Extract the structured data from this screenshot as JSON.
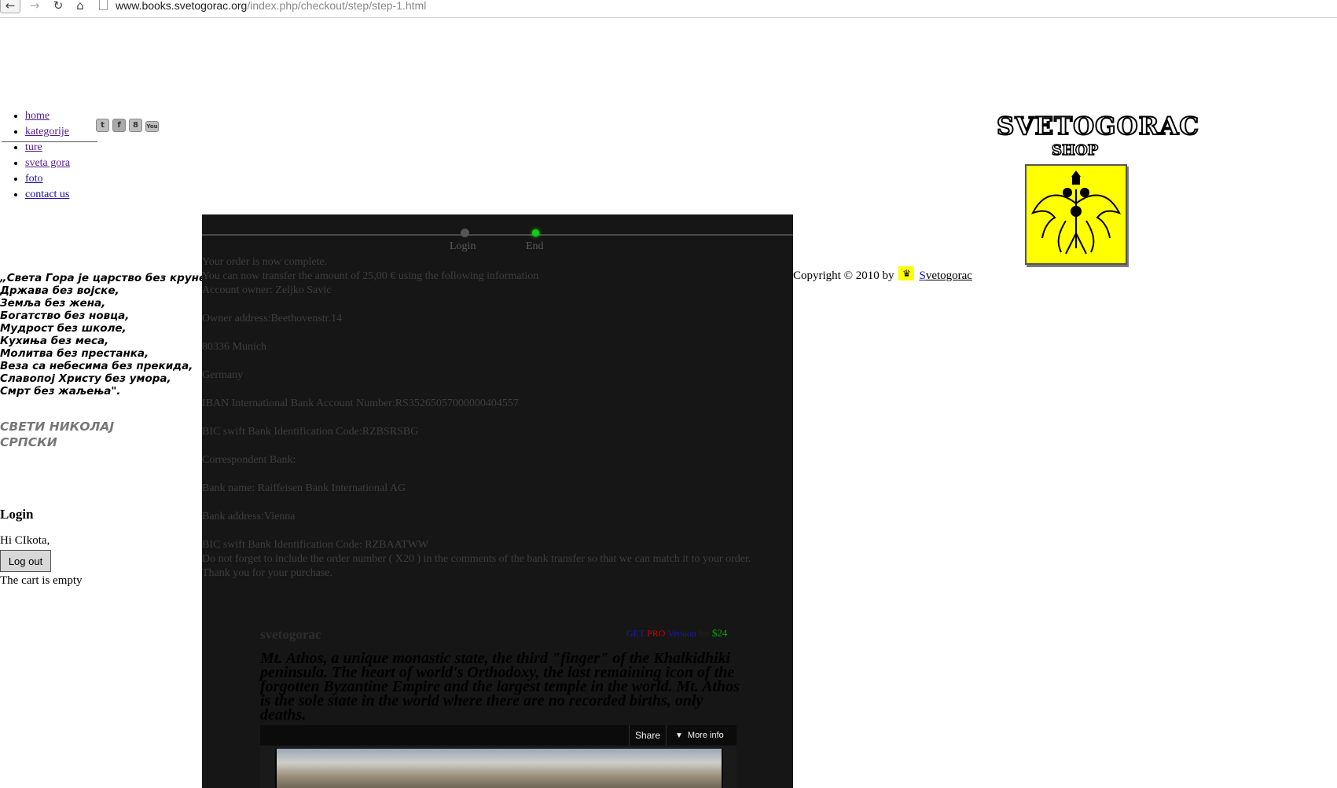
{
  "browser": {
    "back_icon": "arrow-left-icon",
    "forward_icon": "arrow-right-icon",
    "reload_icon": "reload-icon",
    "home_icon": "home-icon",
    "url_domain": "www.books.svetogorac.org",
    "url_path": "/index.php/checkout/step/step-1.html"
  },
  "nav": {
    "items": [
      {
        "label": "home"
      },
      {
        "label": "kategorije"
      },
      {
        "label": "ture"
      },
      {
        "label": "sveta gora"
      },
      {
        "label": "foto"
      },
      {
        "label": "contact us"
      }
    ]
  },
  "social": {
    "icons": [
      "twitter-icon",
      "facebook-icon",
      "google-plus-icon",
      "youtube-icon"
    ]
  },
  "logo": {
    "title": "SVETOGORAC",
    "subtitle": "SHOP",
    "emblem": "double-headed-eagle-emblem"
  },
  "copyright": {
    "prefix": "Copyright © 2010 by",
    "link_first": "S",
    "link_rest": "vetogorac"
  },
  "quote": {
    "lines": [
      "„Света Гора је царство без круне,",
      "Држава без војске,",
      "Земља без жена,",
      "Богатство без новца,",
      "Мудрост без школе,",
      "Кухиња без меса,",
      "Молитва без престанка,",
      "Веза са небесима без прекида,",
      "Славопој Христу без умора,",
      "Смрт без жаљења\"."
    ],
    "author_line1": "СВЕТИ НИКОЛАЈ",
    "author_line2": "СРПСКИ"
  },
  "login": {
    "heading": "Login",
    "greeting": "Hi CIkota,",
    "logout_label": "Log out",
    "cart_status": "The cart is empty"
  },
  "checkout": {
    "steps": [
      {
        "label": "Login",
        "active": false
      },
      {
        "label": "End",
        "active": true
      }
    ],
    "lines": [
      "Your order is now complete.",
      "You can now transfer the amount of 25,00 € using the following information",
      "Account owner: Zeljko Savic",
      "",
      "Owner address:Beethovenstr.14",
      "",
      "80336 Munich",
      "",
      "Germany",
      "",
      "IBAN International Bank Account Number:RS35265057000000404557",
      "",
      "BIC swift Bank Identification Code:RZBSRSBG",
      "",
      "Correspondent Bank:",
      "",
      "Bank name: Raiffeisen Bank International AG",
      "",
      "Bank address:Vienna",
      "",
      "BIC swift Bank Identification Code: RZBAATWW",
      "Do not forget to include the order number ( X20 ) in the comments of the bank transfer so that we can match it to your order.",
      "Thank you for your purchase."
    ]
  },
  "promo": {
    "name": "svetogorac",
    "get": "GET",
    "pro": "PRO",
    "version": "Version",
    "for": "for",
    "price": "$24",
    "tagline": "Mt. Athos, a unique monastic state, the third \"finger\" of the Khalkidhiki peninsula. The heart of world's Orthodoxy, the last remaining icon of the forgotten Byzantine Empire and the largest temple in the world. Mt. Athos is the sole state in the world where there are no recorded births, only deaths."
  },
  "video": {
    "share_label": "Share",
    "more_info_label": "More info",
    "more_info_icon": "double-chevron-down-icon"
  },
  "colors": {
    "panel_bg": "#161616",
    "active_step": "#10d010",
    "emblem_bg": "#ffff00",
    "link": "#1a0dab"
  }
}
